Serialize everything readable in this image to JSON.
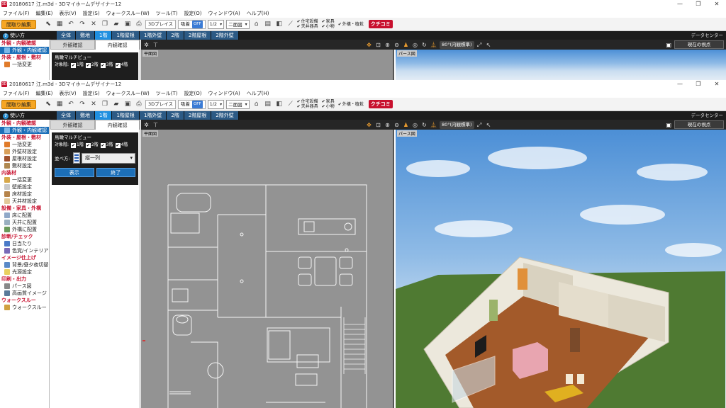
{
  "app": {
    "title": "20180617 江.m3d - 3Dマイホームデザイナー12",
    "window_controls": [
      "—",
      "❐",
      "✕"
    ]
  },
  "menu": [
    "ファイル(F)",
    "編集(E)",
    "表示(V)",
    "設定(S)",
    "ウォークスルー(W)",
    "ツール(T)",
    "設定(O)",
    "ウィンドウ(A)",
    "ヘルプ(H)"
  ],
  "toolbar": {
    "edit_mode": "間取り編集",
    "place3d_label": "3Dプレイス",
    "grid_label": "吸着",
    "grid_state": "OFF",
    "scale_value": "1/2",
    "view_mode": "二面図",
    "checks_group1": [
      "住宅設備",
      "天井器具"
    ],
    "checks_group2": [
      "家具",
      "小物"
    ],
    "checks_group3": [
      "外構・植栽"
    ],
    "logo_text": "クチコミ"
  },
  "floorbar": {
    "howto_label": "使い方",
    "howto_icon": "?",
    "tabs": [
      "全体",
      "敷地",
      "1階",
      "1階屋根",
      "1階外壁",
      "2階",
      "2階屋根",
      "2階外壁"
    ],
    "active_tab": "1階",
    "datacenter_label": "データセンター"
  },
  "leftnav": {
    "sections": [
      {
        "head": "外観・内観確認",
        "items": [
          {
            "label": "外観・内観確認",
            "selected": true
          }
        ]
      },
      {
        "head": "外装・屋根・敷材",
        "items": [
          {
            "label": "一括変更"
          },
          {
            "label": "外壁材設定"
          },
          {
            "label": "屋根材設定"
          },
          {
            "label": "敷材設定"
          }
        ]
      },
      {
        "head": "内装材",
        "items": [
          {
            "label": "一括変更"
          },
          {
            "label": "壁紙設定"
          },
          {
            "label": "床材設定"
          },
          {
            "label": "天井材設定"
          }
        ]
      },
      {
        "head": "設備・家具・外構",
        "items": [
          {
            "label": "床に配置"
          },
          {
            "label": "天井に配置"
          },
          {
            "label": "外構に配置"
          }
        ]
      },
      {
        "head": "診断/チェック",
        "items": [
          {
            "label": "日当たり"
          },
          {
            "label": "色覚/インテリア"
          }
        ]
      },
      {
        "head": "イメージ仕上げ",
        "items": [
          {
            "label": "背景/昼夕夜切替"
          },
          {
            "label": "光源設定"
          }
        ]
      },
      {
        "head": "印刷・出力",
        "items": [
          {
            "label": "パース図"
          },
          {
            "label": "高画質イメージ"
          }
        ]
      },
      {
        "head": "ウォークスルー",
        "items": [
          {
            "label": "ウォークスルー"
          }
        ]
      }
    ]
  },
  "panel": {
    "tabs": [
      "外観確認",
      "内観確認"
    ],
    "active_tab": "内観確認",
    "bird_title": "鳥瞰マルチビュー",
    "target_label": "対象階:",
    "floors": [
      "1階",
      "2階",
      "3階",
      "4階"
    ],
    "arrange_label": "並べ方:",
    "arrange_value": "縦一列",
    "show_button": "表示",
    "end_button": "終了"
  },
  "viewtool": {
    "camera_mode": "80°(内観標準)",
    "current_view": "現在の視点"
  },
  "plan": {
    "label": "平面図"
  },
  "persp": {
    "label": "パース図"
  }
}
